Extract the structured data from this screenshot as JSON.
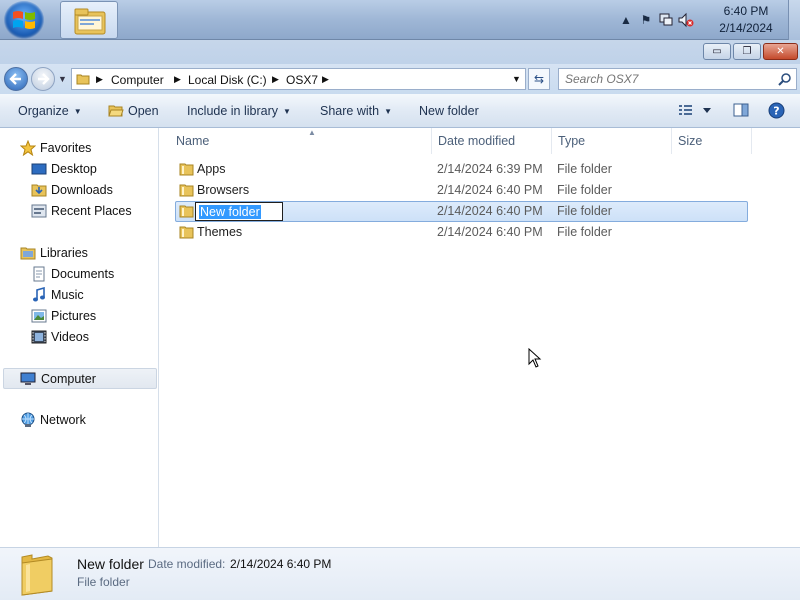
{
  "taskbar": {
    "clock_time": "6:40 PM",
    "clock_date": "2/14/2024",
    "tray_icons": [
      "show-hidden-icon",
      "action-center-flag-icon",
      "network-icon",
      "volume-muted-icon"
    ]
  },
  "window": {
    "controls": {
      "minimize": "▭",
      "maximize": "❐",
      "close": "✕"
    }
  },
  "address": {
    "breadcrumbs": [
      "Computer",
      "Local Disk (C:)",
      "OSX7"
    ],
    "search_placeholder": "Search OSX7"
  },
  "toolbar": {
    "organize": "Organize",
    "open": "Open",
    "include_in_library": "Include in library",
    "share_with": "Share with",
    "new_folder": "New folder"
  },
  "nav": {
    "favorites": "Favorites",
    "desktop": "Desktop",
    "downloads": "Downloads",
    "recent_places": "Recent Places",
    "libraries": "Libraries",
    "documents": "Documents",
    "music": "Music",
    "pictures": "Pictures",
    "videos": "Videos",
    "computer": "Computer",
    "network": "Network"
  },
  "columns": {
    "name": "Name",
    "date_modified": "Date modified",
    "type": "Type",
    "size": "Size"
  },
  "files": [
    {
      "name": "Apps",
      "date": "2/14/2024 6:39 PM",
      "type": "File folder"
    },
    {
      "name": "Browsers",
      "date": "2/14/2024 6:40 PM",
      "type": "File folder"
    },
    {
      "name": "New folder",
      "date": "2/14/2024 6:40 PM",
      "type": "File folder"
    },
    {
      "name": "Themes",
      "date": "2/14/2024 6:40 PM",
      "type": "File folder"
    }
  ],
  "details": {
    "name": "New folder",
    "date_label": "Date modified:",
    "date_value": "2/14/2024 6:40 PM",
    "type": "File folder"
  },
  "colors": {
    "selection": "#cde1f8",
    "selection_border": "#84acdd",
    "rename_highlight": "#3399ff"
  }
}
